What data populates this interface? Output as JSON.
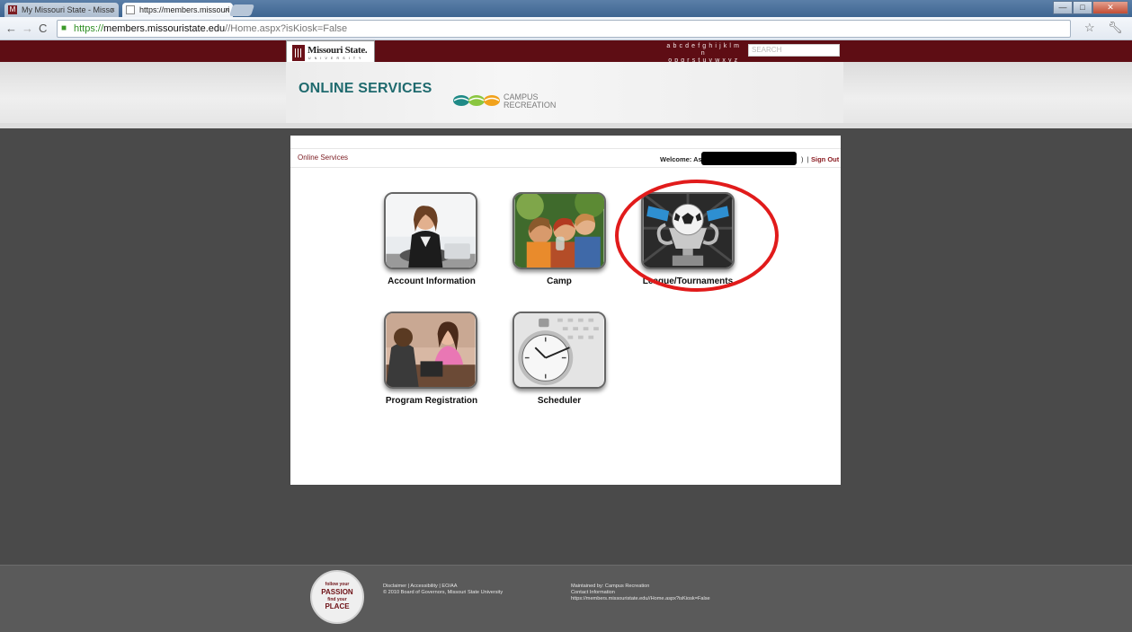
{
  "browser": {
    "tabs": [
      {
        "label": "My Missouri State - Misso",
        "favicon": "M"
      },
      {
        "label": "https://members.missouri",
        "favicon": "page"
      }
    ],
    "url": {
      "scheme": "https://",
      "host": "members.missouristate.edu",
      "path": "//Home.aspx?isKiosk=False"
    },
    "window_controls": {
      "minimize": "—",
      "maximize": "□",
      "close": "✕"
    }
  },
  "header": {
    "logo_name": "Missouri State.",
    "logo_sub": "U N I V E R S I T Y",
    "az_line1": "a b c d e f g h i j k l m n",
    "az_line2": "o p q r s t u v w x y z",
    "search_placeholder": "SEARCH",
    "section_title": "ONLINE SERVICES",
    "dept_line1": "CAMPUS",
    "dept_line2": "RECREATION"
  },
  "subnav": {
    "breadcrumb": "Online Services",
    "welcome": "Welcome: As",
    "welcome_tail": ")",
    "separator": "|",
    "signout": "Sign Out"
  },
  "tiles": [
    {
      "label": "Account Information",
      "icon": "office-woman-icon"
    },
    {
      "label": "Camp",
      "icon": "kids-camp-icon"
    },
    {
      "label": "League/Tournaments",
      "icon": "soccer-trophy-icon"
    },
    {
      "label": "Program Registration",
      "icon": "meeting-icon"
    },
    {
      "label": "Scheduler",
      "icon": "stopwatch-icon"
    }
  ],
  "footer": {
    "badge": [
      "follow your",
      "PASSION",
      "find your",
      "PLACE"
    ],
    "links_line1": "Disclaimer  |  Accessibility  |  EO/AA",
    "links_line2": "© 2010 Board of Governors, Missouri State University",
    "maint_line1": "Maintained by: Campus Recreation",
    "maint_line2": "Contact Information",
    "maint_line3": "https://members.missouristate.edu//Home.aspx?isKiosk=False"
  }
}
